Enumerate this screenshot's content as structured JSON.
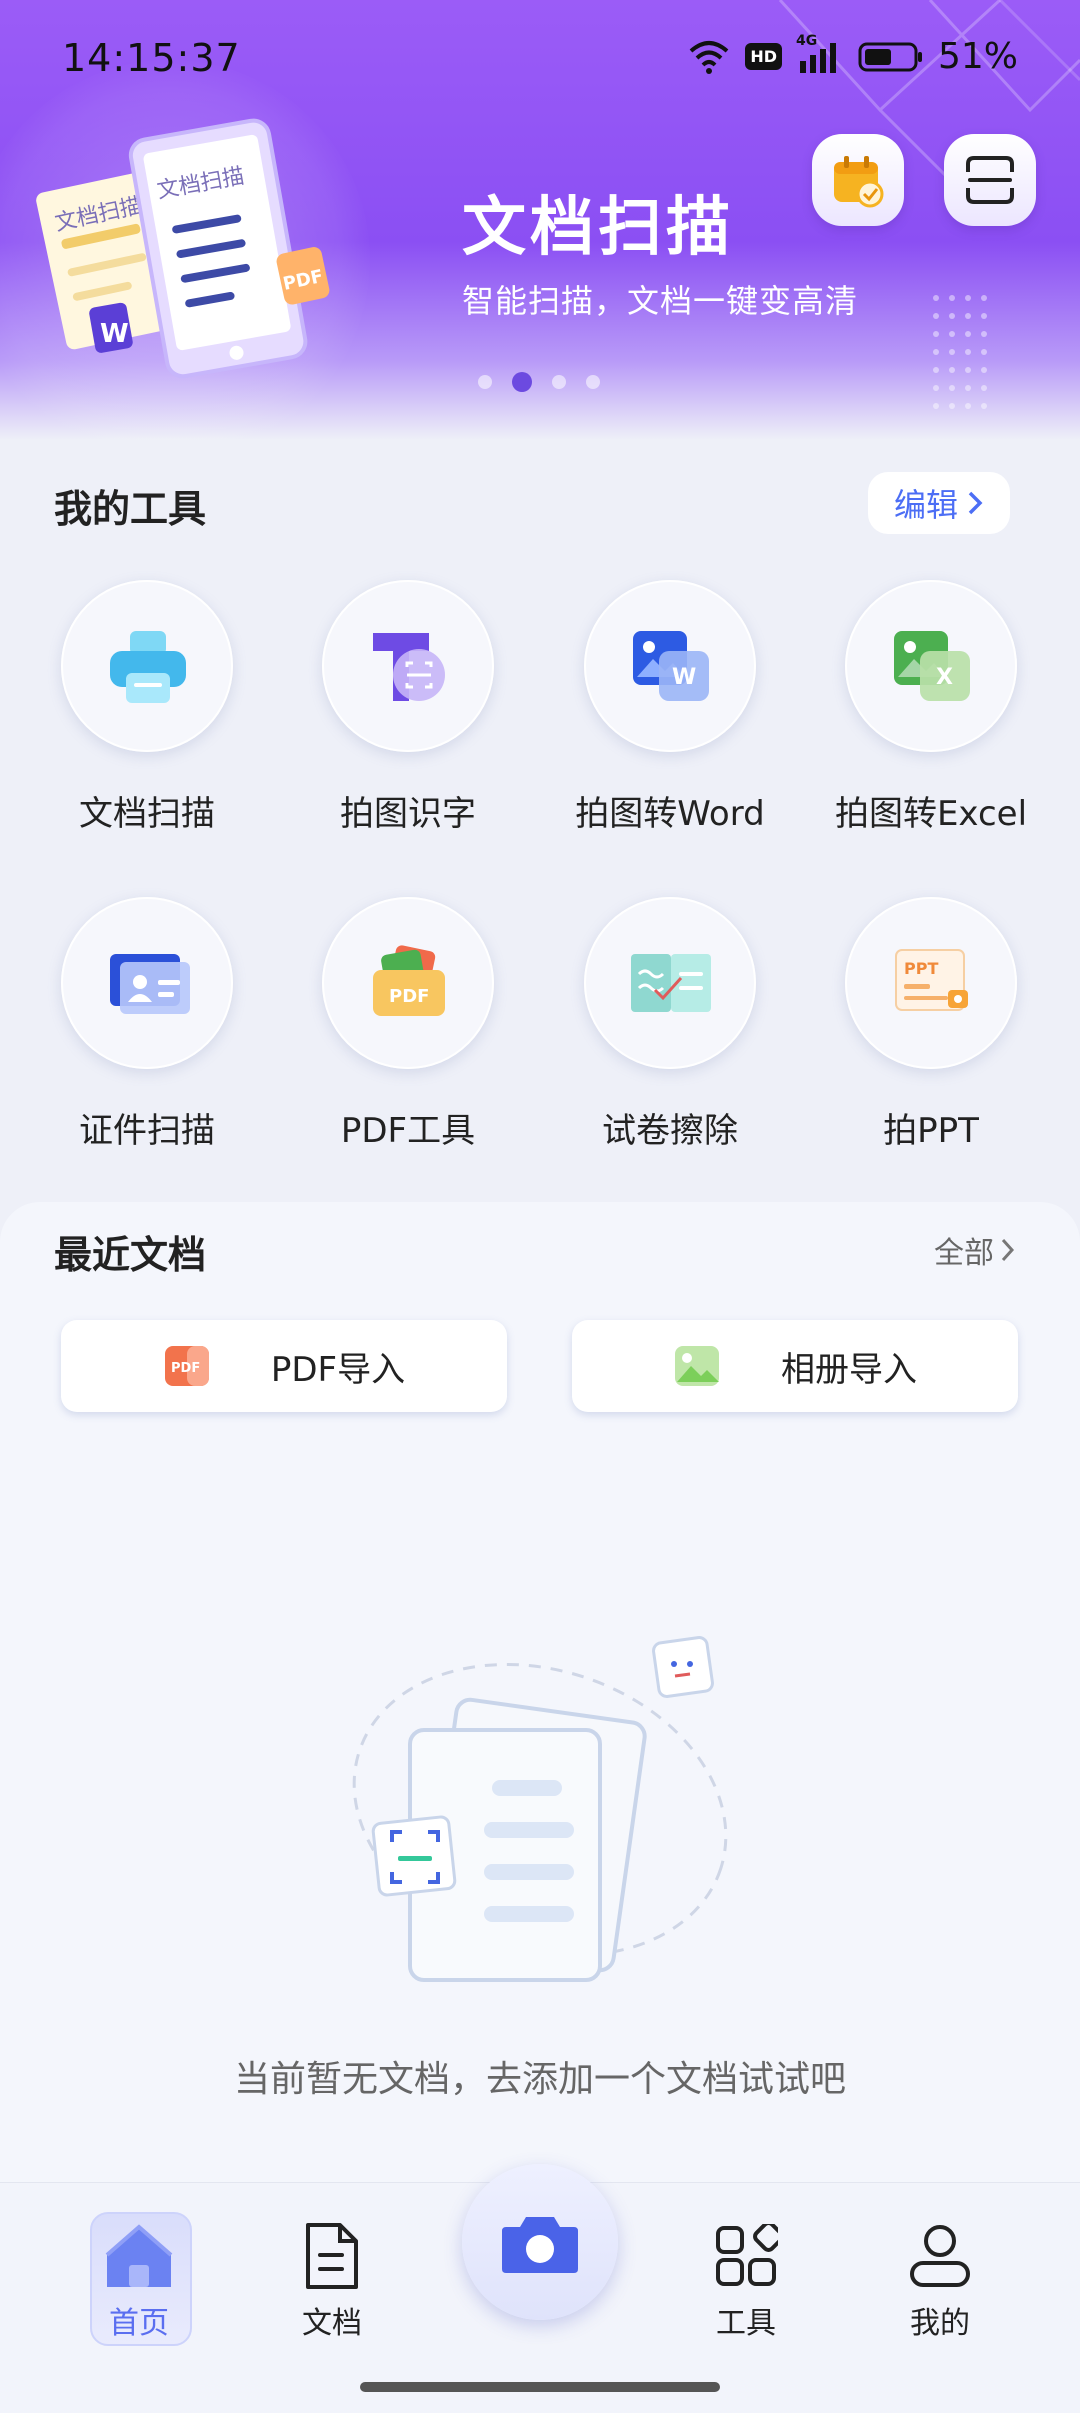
{
  "status_bar": {
    "time": "14:15:37",
    "network": "4G",
    "hd": "HD",
    "battery": "51%"
  },
  "banner": {
    "title": "文档扫描",
    "subtitle": "智能扫描，文档一键变高清",
    "illustration": {
      "doc_left": "文档扫描",
      "doc_right": "文档扫描",
      "pdf_badge": "PDF",
      "word_badge": "W"
    },
    "active_slide": 2,
    "slide_count": 4
  },
  "header_buttons": {
    "calendar_icon": "calendar-check-icon",
    "scan_icon": "scan-frame-icon"
  },
  "my_tools": {
    "title": "我的工具",
    "edit_label": "编辑",
    "items": [
      {
        "label": "文档扫描",
        "icon": "printer-icon"
      },
      {
        "label": "拍图识字",
        "icon": "text-recognition-icon"
      },
      {
        "label": "拍图转Word",
        "icon": "word-convert-icon"
      },
      {
        "label": "拍图转Excel",
        "icon": "excel-convert-icon"
      },
      {
        "label": "证件扫描",
        "icon": "id-card-icon"
      },
      {
        "label": "PDF工具",
        "icon": "pdf-tools-icon",
        "icon_text": "PDF"
      },
      {
        "label": "试卷擦除",
        "icon": "exam-erase-icon"
      },
      {
        "label": "拍PPT",
        "icon": "ppt-icon",
        "icon_text": "PPT"
      }
    ]
  },
  "recent_docs": {
    "title": "最近文档",
    "all_label": "全部",
    "pdf_import_label": "PDF导入",
    "pdf_icon_text": "PDF",
    "album_import_label": "相册导入",
    "empty_text": "当前暂无文档，去添加一个文档试试吧"
  },
  "bottom_nav": {
    "home_label": "首页",
    "docs_label": "文档",
    "tools_label": "工具",
    "mine_label": "我的",
    "active": "首页"
  },
  "colors": {
    "accent": "#4c6ef5",
    "banner": "#8b4ff3",
    "nav_active": "#5a6ef0"
  }
}
